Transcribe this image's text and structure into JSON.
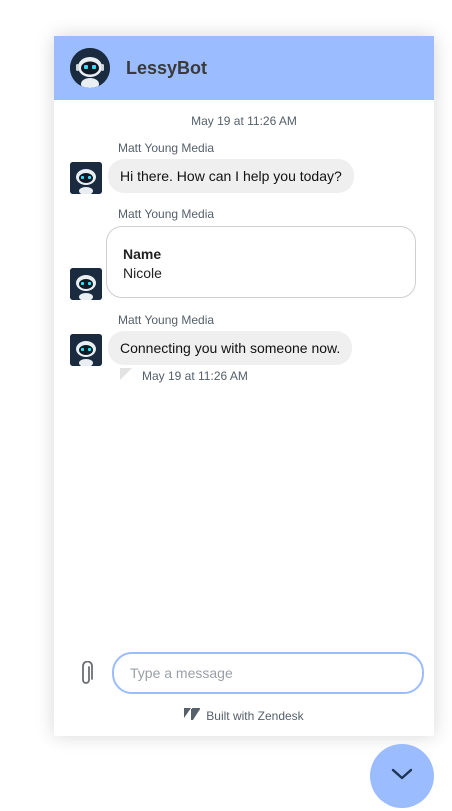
{
  "header": {
    "title": "LessyBot",
    "avatar_icon": "robot-avatar-icon",
    "bg_color": "#9bbcff"
  },
  "conversation": {
    "timestamp_top": "May 19 at 11:26 AM",
    "messages": [
      {
        "sender": "Matt Young Media",
        "text": "Hi there. How can I help you today?"
      },
      {
        "sender": "Matt Young Media",
        "form": {
          "label": "Name",
          "value": "Nicole"
        }
      },
      {
        "sender": "Matt Young Media",
        "text": "Connecting you with someone now."
      }
    ],
    "timestamp_bottom": "May 19 at 11:26 AM"
  },
  "composer": {
    "attach_icon": "paperclip-icon",
    "placeholder": "Type a message",
    "value": ""
  },
  "footer": {
    "brand_icon": "zendesk-logo-icon",
    "built_with": "Built with Zendesk"
  },
  "launcher": {
    "icon": "chevron-down-icon",
    "color": "#9bbcff"
  }
}
